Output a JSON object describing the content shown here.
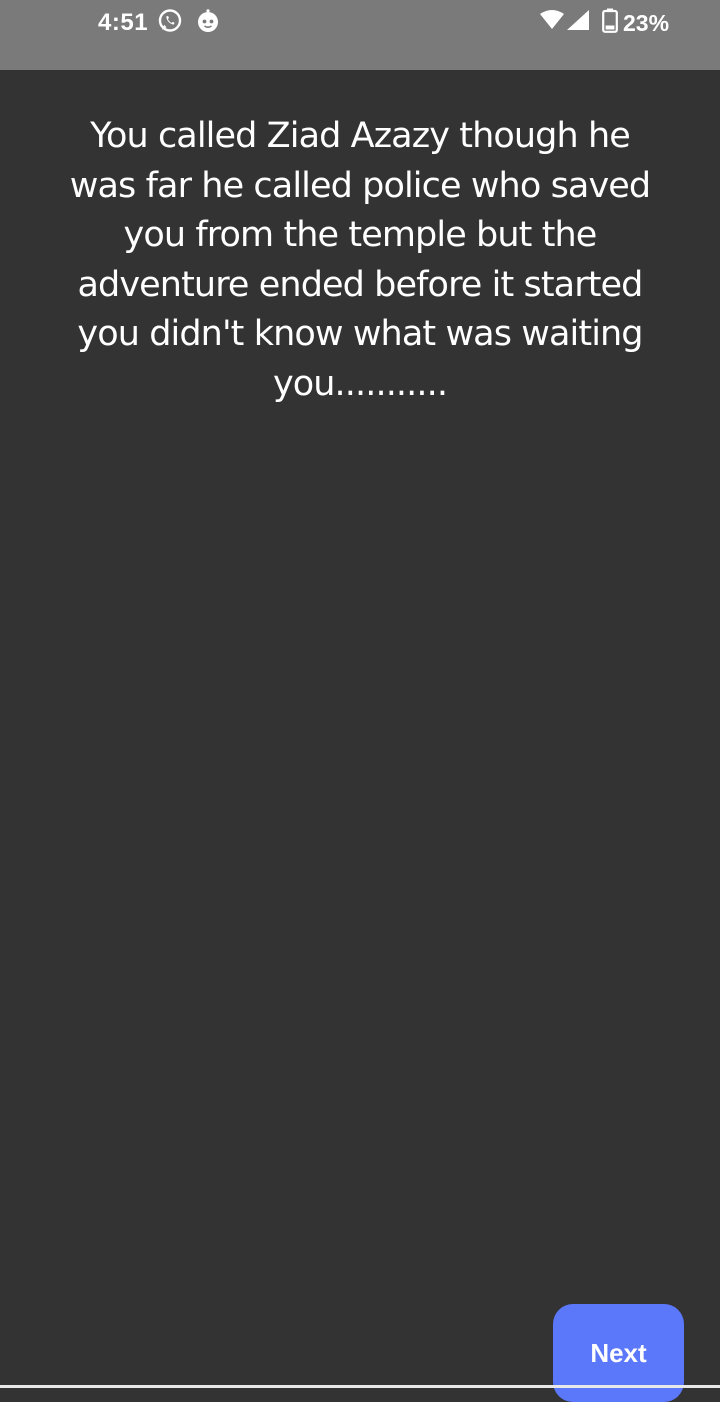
{
  "status_bar": {
    "time": "4:51",
    "battery": "23%",
    "icons": [
      "whatsapp-icon",
      "app-notification-icon",
      "wifi-icon",
      "cell-signal-icon",
      "battery-icon"
    ]
  },
  "story": {
    "text": "You called Ziad Azazy though he was far he called police who saved you from the temple but the adventure ended before it started you didn't know what was waiting you..........."
  },
  "next_button": {
    "label": "Next"
  },
  "colors": {
    "status_bar_bg": "#7a7a7a",
    "screen_bg": "#333333",
    "text": "#ffffff",
    "accent": "#5b78fb"
  }
}
